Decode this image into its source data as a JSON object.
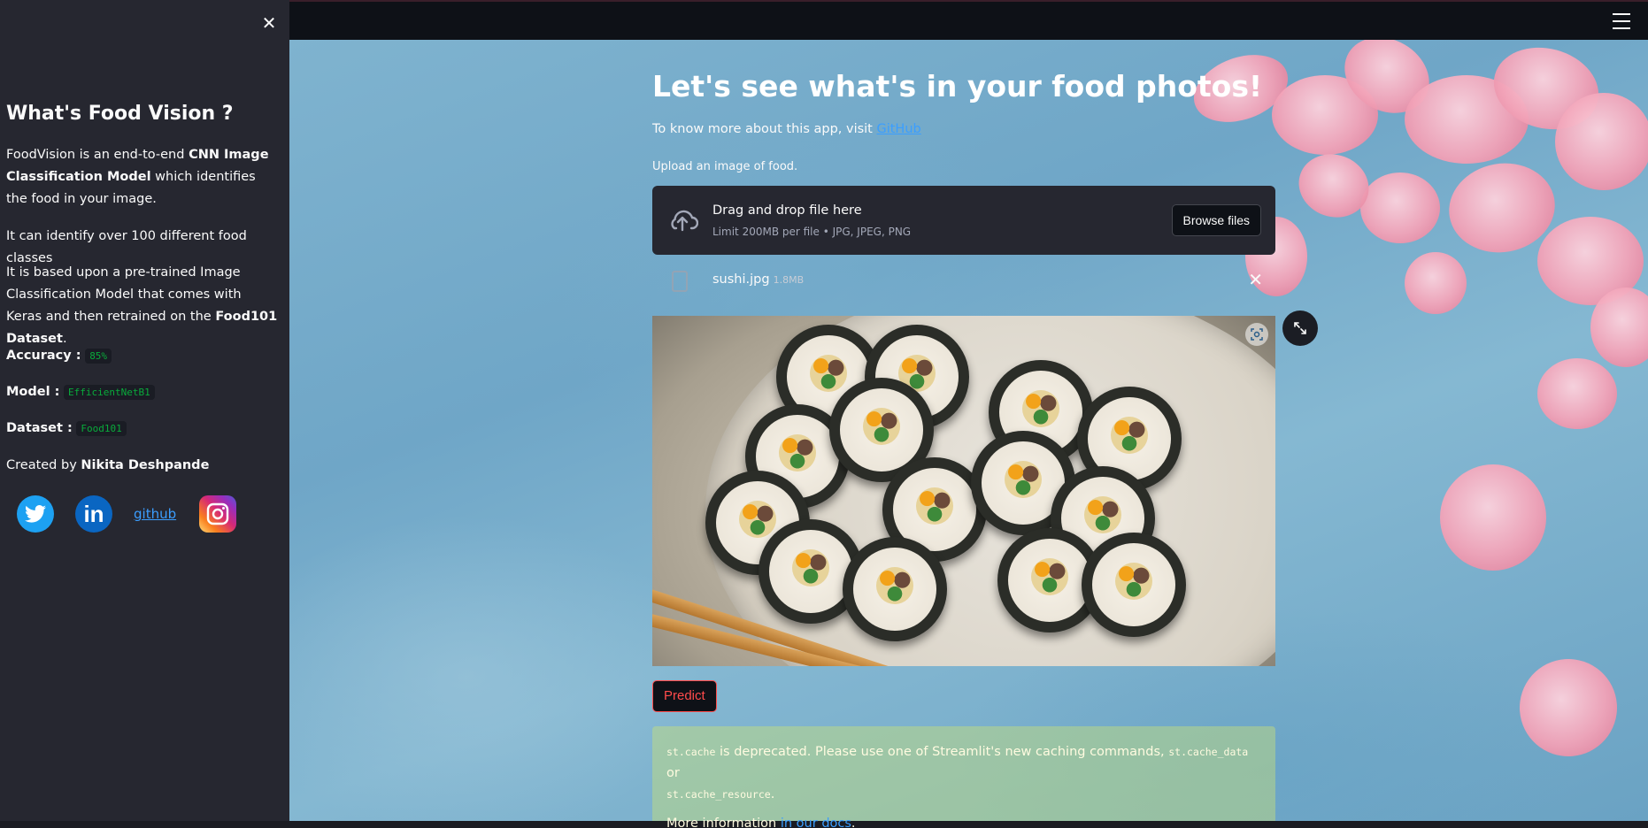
{
  "sidebar": {
    "title": "What's Food Vision ?",
    "p1_a": "FoodVision is an end-to-end ",
    "p1_b": "CNN Image Classification Model",
    "p1_c": " which identifies the food in your image.",
    "p2": "It can identify over 100 different food classes",
    "p3_a": "It is based upon a pre-trained Image Classification Model that comes with Keras and then retrained on the ",
    "p3_b": "Food101 Dataset",
    "p3_c": ".",
    "accuracy_label": "Accuracy :",
    "accuracy_value": "85%",
    "model_label": "Model :",
    "model_value": "EfficientNetB1",
    "dataset_label": "Dataset :",
    "dataset_value": "Food101",
    "created_prefix": "Created by ",
    "created_name": "Nikita Deshpande",
    "social": {
      "twitter_icon": "twitter-icon",
      "linkedin_glyph": "in",
      "github_alt": "github",
      "instagram_icon": "instagram-icon"
    }
  },
  "main": {
    "title": "Let's see what's in your food photos!",
    "subline_prefix": "To know more about this app, visit ",
    "subline_link": "GitHub",
    "upload_label": "Upload an image of food.",
    "dropzone_main": "Drag and drop file here",
    "dropzone_sub": "Limit 200MB per file • JPG, JPEG, PNG",
    "browse_label": "Browse files",
    "file_name": "sushi.jpg",
    "file_size": "1.8MB",
    "predict_label": "Predict",
    "warning": {
      "code1": "st.cache",
      "text1": " is deprecated. Please use one of Streamlit's new caching commands, ",
      "code2": "st.cache_data",
      "text2": " or ",
      "code3": "st.cache_resource",
      "text3": ".",
      "more_prefix": "More information ",
      "more_link": "in our docs",
      "more_suffix": "."
    }
  },
  "colors": {
    "accent": "#ff4b4b",
    "link": "#3b9eff",
    "code": "#09ab3b",
    "sidebar_bg": "#262730"
  }
}
